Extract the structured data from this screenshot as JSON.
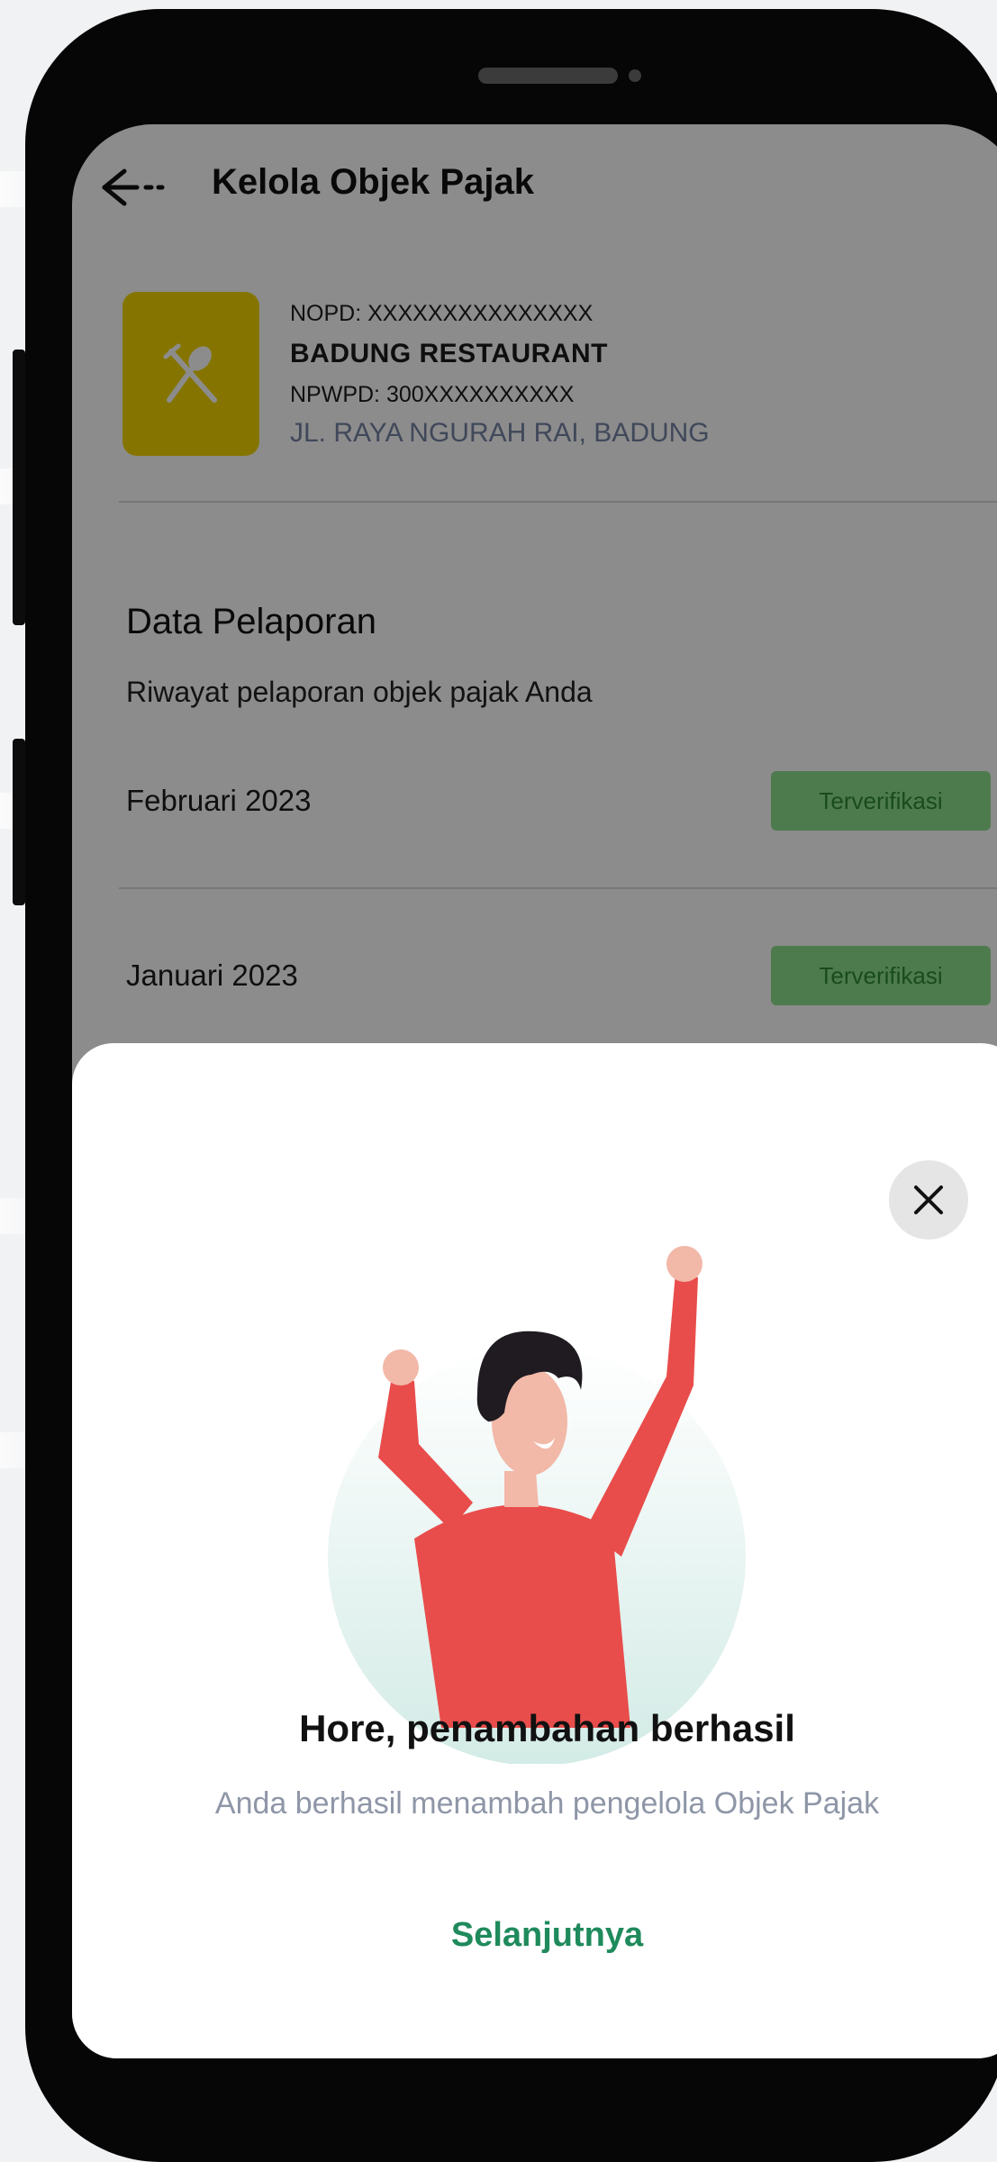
{
  "header": {
    "title": "Kelola Objek Pajak",
    "back_icon": "arrow-left-icon"
  },
  "object": {
    "nopd": "NOPD: XXXXXXXXXXXXXXX",
    "name": "BADUNG RESTAURANT",
    "npwpd": "NPWPD: 300XXXXXXXXXX",
    "address": "JL. RAYA NGURAH RAI, BADUNG",
    "icon": "fork-spoon-icon",
    "logo_color": "#F2D600"
  },
  "section": {
    "title": "Data Pelaporan",
    "subtitle": "Riwayat pelaporan objek pajak Anda"
  },
  "reports": [
    {
      "period": "Februari 2023",
      "status": "Terverifikasi"
    },
    {
      "period": "Januari 2023",
      "status": "Terverifikasi"
    }
  ],
  "dialog": {
    "title": "Hore, penambahan berhasil",
    "message": "Anda berhasil menambah pengelola Objek Pajak",
    "button": "Selanjutnya",
    "close_icon": "close-icon",
    "illustration": "celebrating-person-illustration"
  },
  "colors": {
    "accent_green": "#1F8A5C",
    "status_green": "#8EE08F",
    "status_text": "#2E8B34",
    "address_text": "#7683A5"
  }
}
